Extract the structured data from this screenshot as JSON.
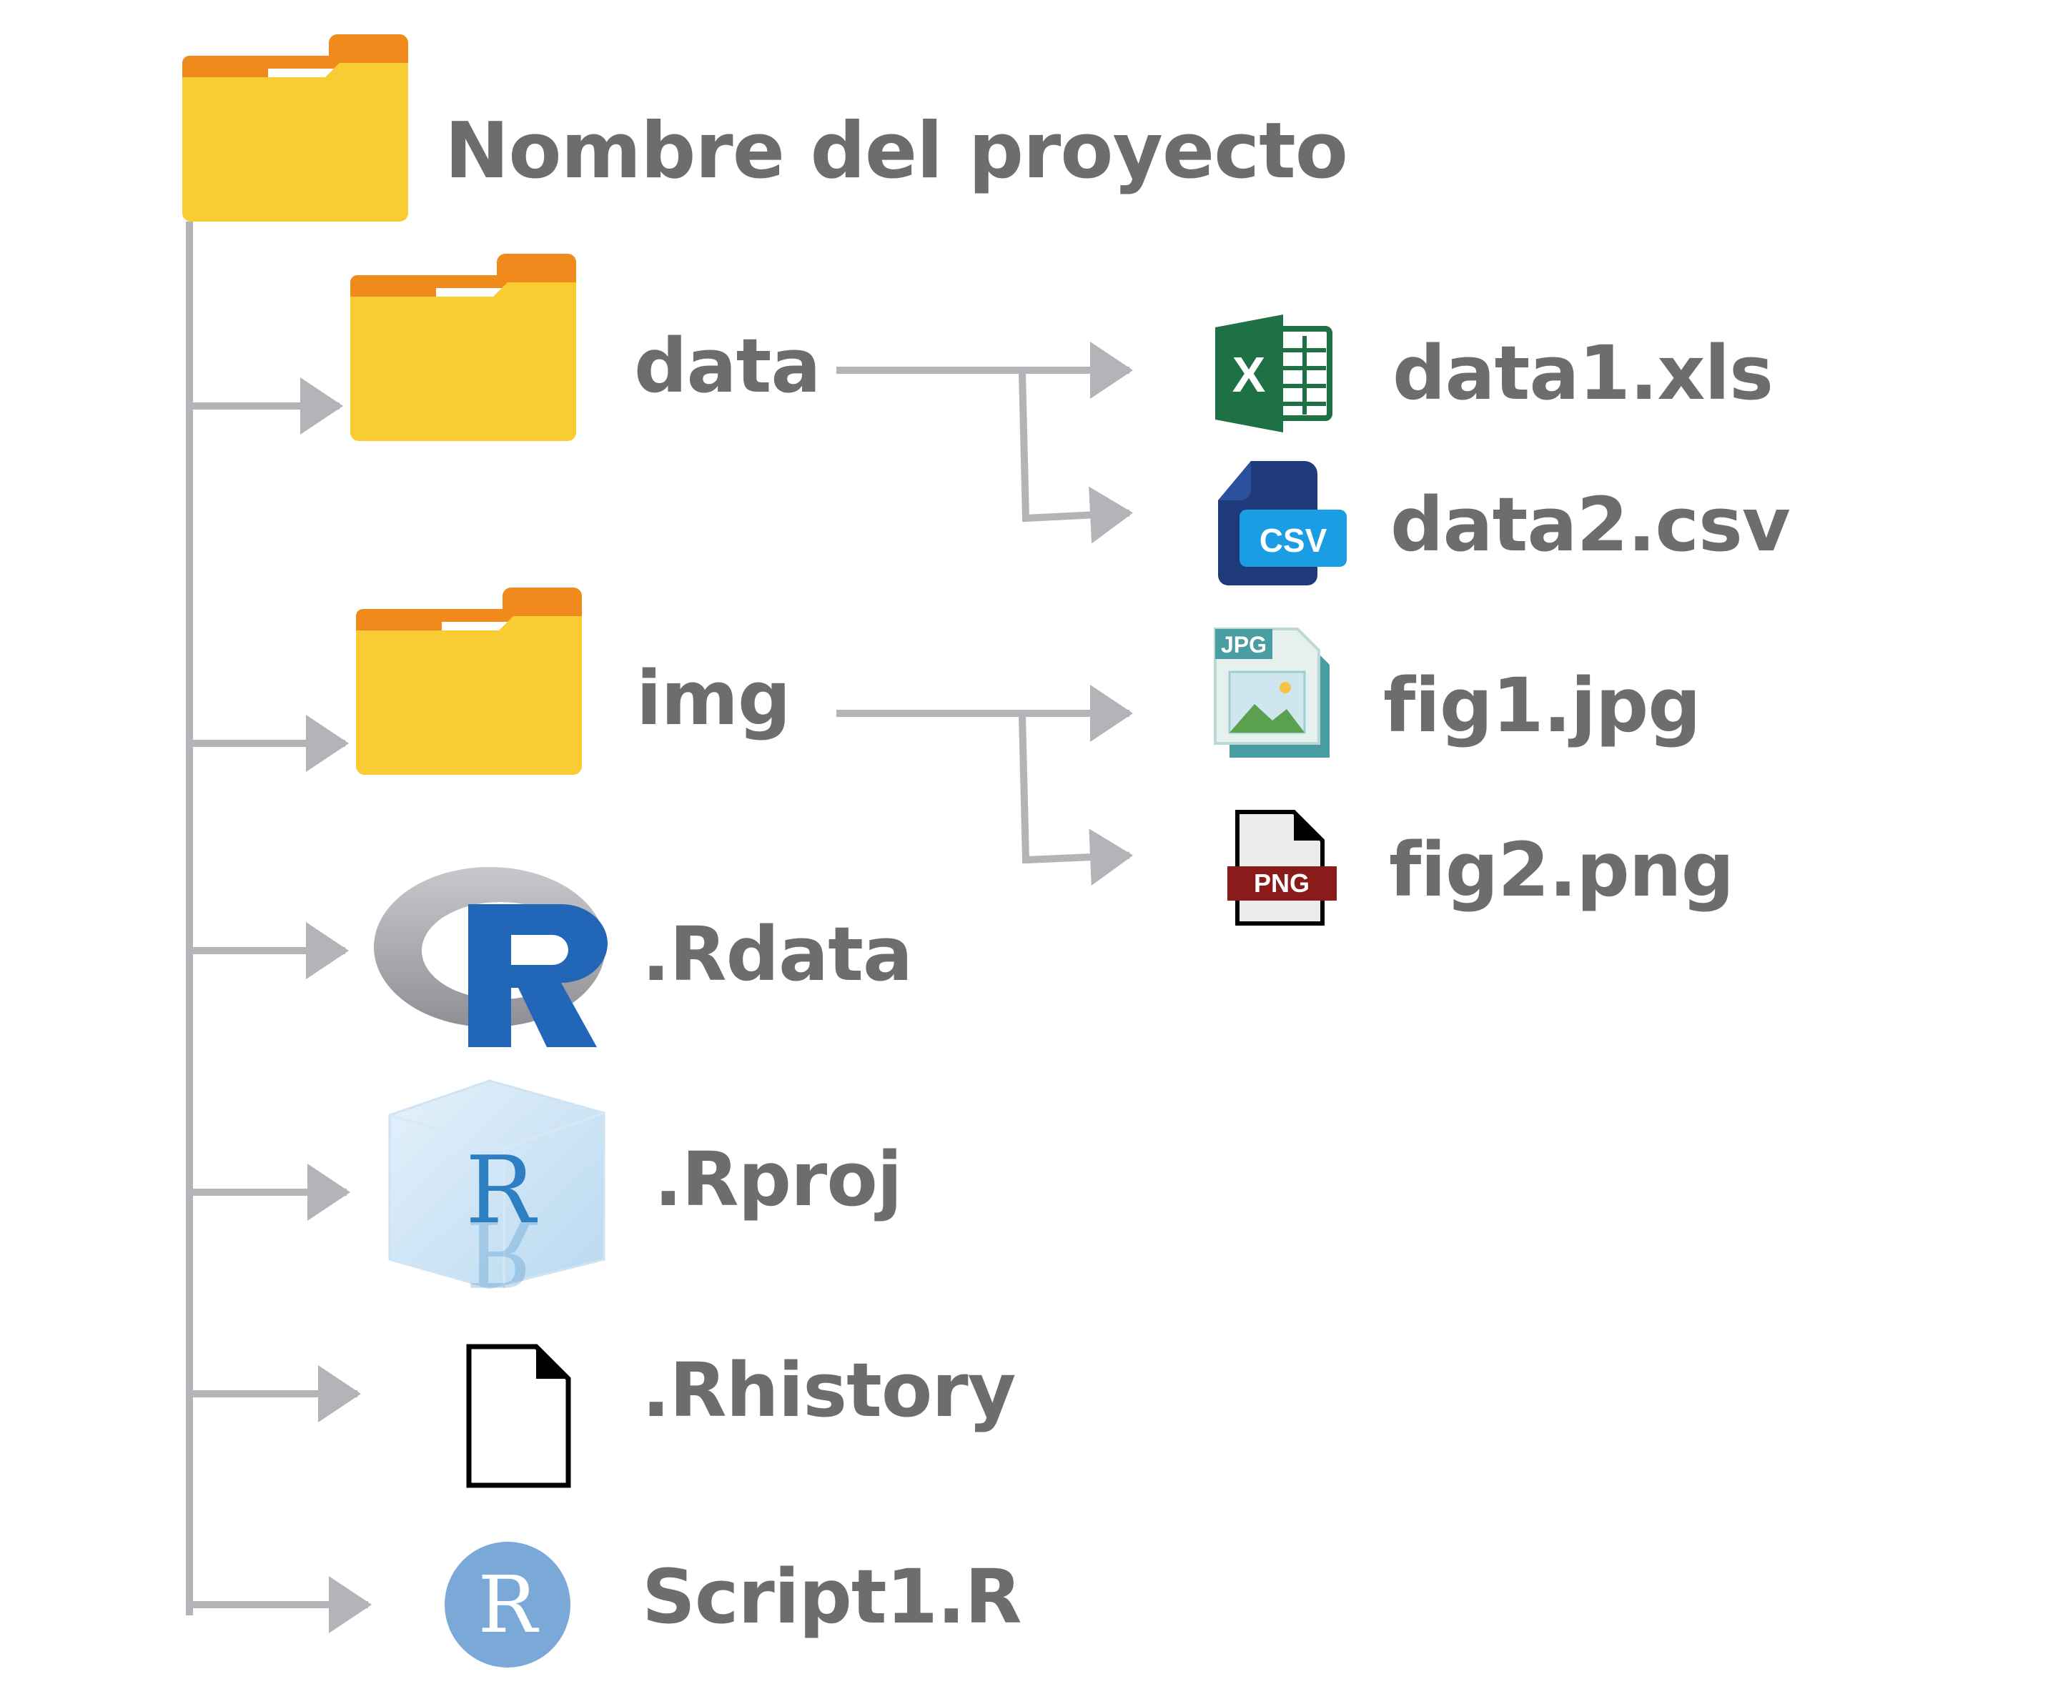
{
  "root": {
    "label": "Nombre del proyecto",
    "icon": "folder-icon"
  },
  "children": [
    {
      "label": "data",
      "icon": "folder-icon",
      "files": [
        {
          "label": "data1.xls",
          "icon": "excel-icon"
        },
        {
          "label": "data2.csv",
          "icon": "csv-file-icon",
          "badge": "CSV"
        }
      ]
    },
    {
      "label": "img",
      "icon": "folder-icon",
      "files": [
        {
          "label": "fig1.jpg",
          "icon": "jpg-image-icon",
          "badge": "JPG"
        },
        {
          "label": "fig2.png",
          "icon": "png-file-icon",
          "badge": "PNG"
        }
      ]
    },
    {
      "label": ".Rdata",
      "icon": "r-logo-icon"
    },
    {
      "label": ".Rproj",
      "icon": "rproj-cube-icon",
      "badge": "R"
    },
    {
      "label": ".Rhistory",
      "icon": "blank-file-icon"
    },
    {
      "label": "Script1.R",
      "icon": "r-script-icon",
      "badge": "R"
    }
  ],
  "colors": {
    "text": "#6d6d6d",
    "connector": "#b3b3b8",
    "folder_body": "#f9cc33",
    "folder_tab": "#f08a1c",
    "excel": "#1e7145",
    "csv": "#1f3a7a",
    "r_blue": "#2266b8",
    "r_script": "#7aa9d8",
    "png_band": "#8b1a1a"
  }
}
